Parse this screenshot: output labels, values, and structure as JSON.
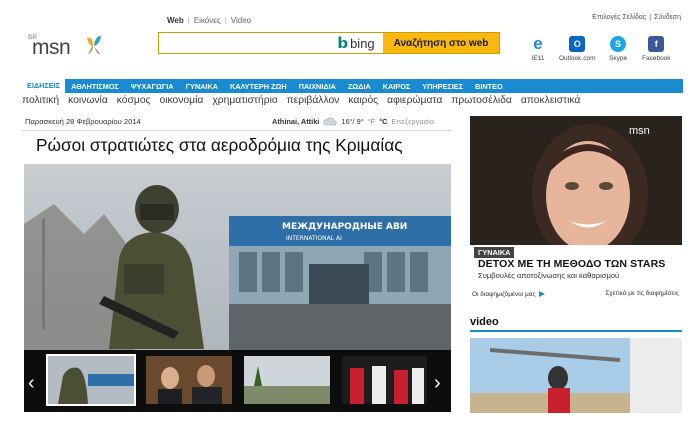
{
  "search_tabs": [
    "Web",
    "Εικόνες",
    "Video"
  ],
  "top_links": [
    "Επιλογές Σελίδας",
    "Σύνδεση"
  ],
  "logo": {
    "region": "GR",
    "name": "msn"
  },
  "search": {
    "placeholder": "",
    "bing": "bing",
    "button": "Αναζήτηση στο web"
  },
  "quick_links": [
    {
      "label": "IE11",
      "icon": "internet-explorer-icon",
      "color": "#1f8ad6"
    },
    {
      "label": "Outlook.com",
      "icon": "outlook-icon",
      "color": "#0a66c2"
    },
    {
      "label": "Skype",
      "icon": "skype-icon",
      "color": "#1aa5e3"
    },
    {
      "label": "Facebook",
      "icon": "facebook-icon",
      "color": "#3b5998"
    }
  ],
  "nav": [
    "ΕΙΔΗΣΕΙΣ",
    "ΑΘΛΗΤΙΣΜΟΣ",
    "ΨΥΧΑΓΩΓΙΑ",
    "ΓΥΝΑΙΚΑ",
    "ΚΑΛΥΤΕΡΗ ΖΩΗ",
    "ΠΑΙΧΝΙΔΙΑ",
    "ΖΩΔΙΑ",
    "ΚΑΙΡΟΣ",
    "ΥΠΗΡΕΣΙΕΣ",
    "ΒΙΝΤΕΟ"
  ],
  "subnav": [
    "πολιτική",
    "κοινωνία",
    "κόσμος",
    "οικονομία",
    "χρηματιστήριο",
    "περιβάλλον",
    "καιρός",
    "αφιερώματα",
    "πρωτοσέλιδα",
    "αποκλειστικά"
  ],
  "date": "Παρασκευή 28 Φεβρουαρίου 2014",
  "weather": {
    "location": "Athinai, Attiki",
    "temp": "16°/ 9°",
    "unit_f": "°F",
    "unit_c": "°C",
    "update": "Επεξεργασία"
  },
  "headline": "Ρώσοι στρατιώτες στα αεροδρόμια της Κριμαίας",
  "photo": {
    "sign_line1": "МЕЖДУНАРОДНЫЕ АВИ",
    "sign_line2": "INTERNATIONAL AI"
  },
  "carousel": {
    "prev": "‹",
    "next": "›"
  },
  "ad": {
    "msn": "msn",
    "tag": "ΓΥΝΑΙΚΑ",
    "title": "DETOX ΜΕ ΤΗ ΜΕΘΟΔΟ ΤΩΝ STARS",
    "subtitle": "Συμβουλές αποτοξίνωσης και καθαρισμού",
    "partners": "Οι διαφημιζόμενοι μας",
    "about": "Σχετικά με τις διαφημίσεις"
  },
  "video": {
    "heading": "video"
  }
}
